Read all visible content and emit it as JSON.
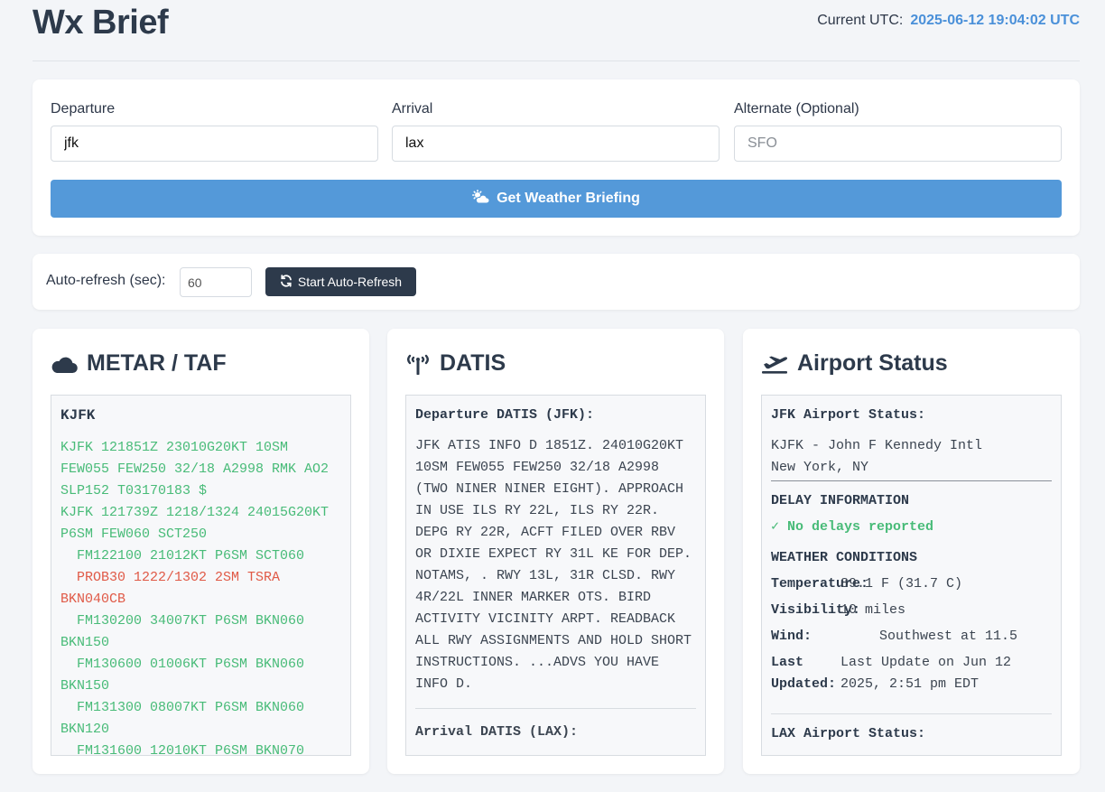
{
  "header": {
    "title": "Wx Brief",
    "utc_label": "Current UTC:",
    "utc_value": "2025-06-12 19:04:02 UTC"
  },
  "route": {
    "departure": {
      "label": "Departure",
      "value": "jfk",
      "placeholder": ""
    },
    "arrival": {
      "label": "Arrival",
      "value": "lax",
      "placeholder": ""
    },
    "alternate": {
      "label": "Alternate (Optional)",
      "value": "",
      "placeholder": "SFO"
    },
    "brief_button": {
      "label": "Get Weather Briefing",
      "icon": "cloud-sun-icon"
    }
  },
  "refresh": {
    "label": "Auto-refresh (sec):",
    "value": "60",
    "button": {
      "label": "Start Auto-Refresh",
      "icon": "sync-icon"
    }
  },
  "metar_panel": {
    "title": "METAR / TAF",
    "icon": "cloud-icon",
    "station": "KJFK",
    "lines": [
      {
        "text": "KJFK 121851Z 23010G20KT 10SM FEW055 FEW250 32/18 A2998 RMK AO2 SLP152 T03170183 $",
        "kind": "normal"
      },
      {
        "text": "KJFK 121739Z 1218/1324 24015G20KT P6SM FEW060 SCT250",
        "kind": "normal"
      },
      {
        "text": "  FM122100 21012KT P6SM SCT060",
        "kind": "normal"
      },
      {
        "text": "  PROB30 1222/1302 2SM TSRA BKN040CB",
        "kind": "prob"
      },
      {
        "text": "  FM130200 34007KT P6SM BKN060 BKN150",
        "kind": "normal"
      },
      {
        "text": "  FM130600 01006KT P6SM BKN060 BKN150",
        "kind": "normal"
      },
      {
        "text": "  FM131300 08007KT P6SM BKN060 BKN120",
        "kind": "normal"
      },
      {
        "text": "  FM131600 12010KT P6SM BKN070",
        "kind": "normal"
      }
    ],
    "colors": {
      "normal": "#48bb78",
      "prob": "#e05a47"
    }
  },
  "datis_panel": {
    "title": "DATIS",
    "icon": "broadcast-tower-icon",
    "dep_heading": "Departure DATIS (JFK):",
    "dep_text": "JFK ATIS INFO D 1851Z. 24010G20KT 10SM FEW055 FEW250 32/18 A2998 (TWO NINER NINER EIGHT). APPROACH IN USE ILS RY 22L, ILS RY 22R. DEPG RY 22R, ACFT FILED OVER RBV OR DIXIE EXPECT RY 31L KE FOR DEP. NOTAMS, . RWY 13L, 31R CLSD. RWY 4R/22L INNER MARKER OTS. BIRD ACTIVITY VICINITY ARPT. READBACK ALL RWY ASSIGNMENTS AND HOLD SHORT INSTRUCTIONS. ...ADVS YOU HAVE INFO D.",
    "arr_heading": "Arrival DATIS (LAX):"
  },
  "status_panel": {
    "title": "Airport Status",
    "icon": "plane-departure-icon",
    "dep_heading": "JFK Airport Status:",
    "dep_name": "KJFK - John F Kennedy Intl",
    "dep_city": "New York, NY",
    "delay_heading": "DELAY INFORMATION",
    "delay_text": "✓ No delays reported",
    "weather_heading": "WEATHER CONDITIONS",
    "temperature_label": "Temperature:",
    "temperature_value": "89.1 F (31.7 C)",
    "visibility_label": "Visibility:",
    "visibility_value": "10 miles",
    "wind_label": "Wind:",
    "wind_value": "Southwest at 11.5",
    "updated_label": "Last Updated:",
    "updated_value": "Last Update on Jun 12 2025, 2:51 pm EDT",
    "arr_heading": "LAX Airport Status:"
  },
  "colors": {
    "accent": "#5499d9",
    "dark": "#2d3a4b",
    "success": "#48bb78",
    "danger": "#e05a47",
    "utc": "#4a90d9"
  }
}
